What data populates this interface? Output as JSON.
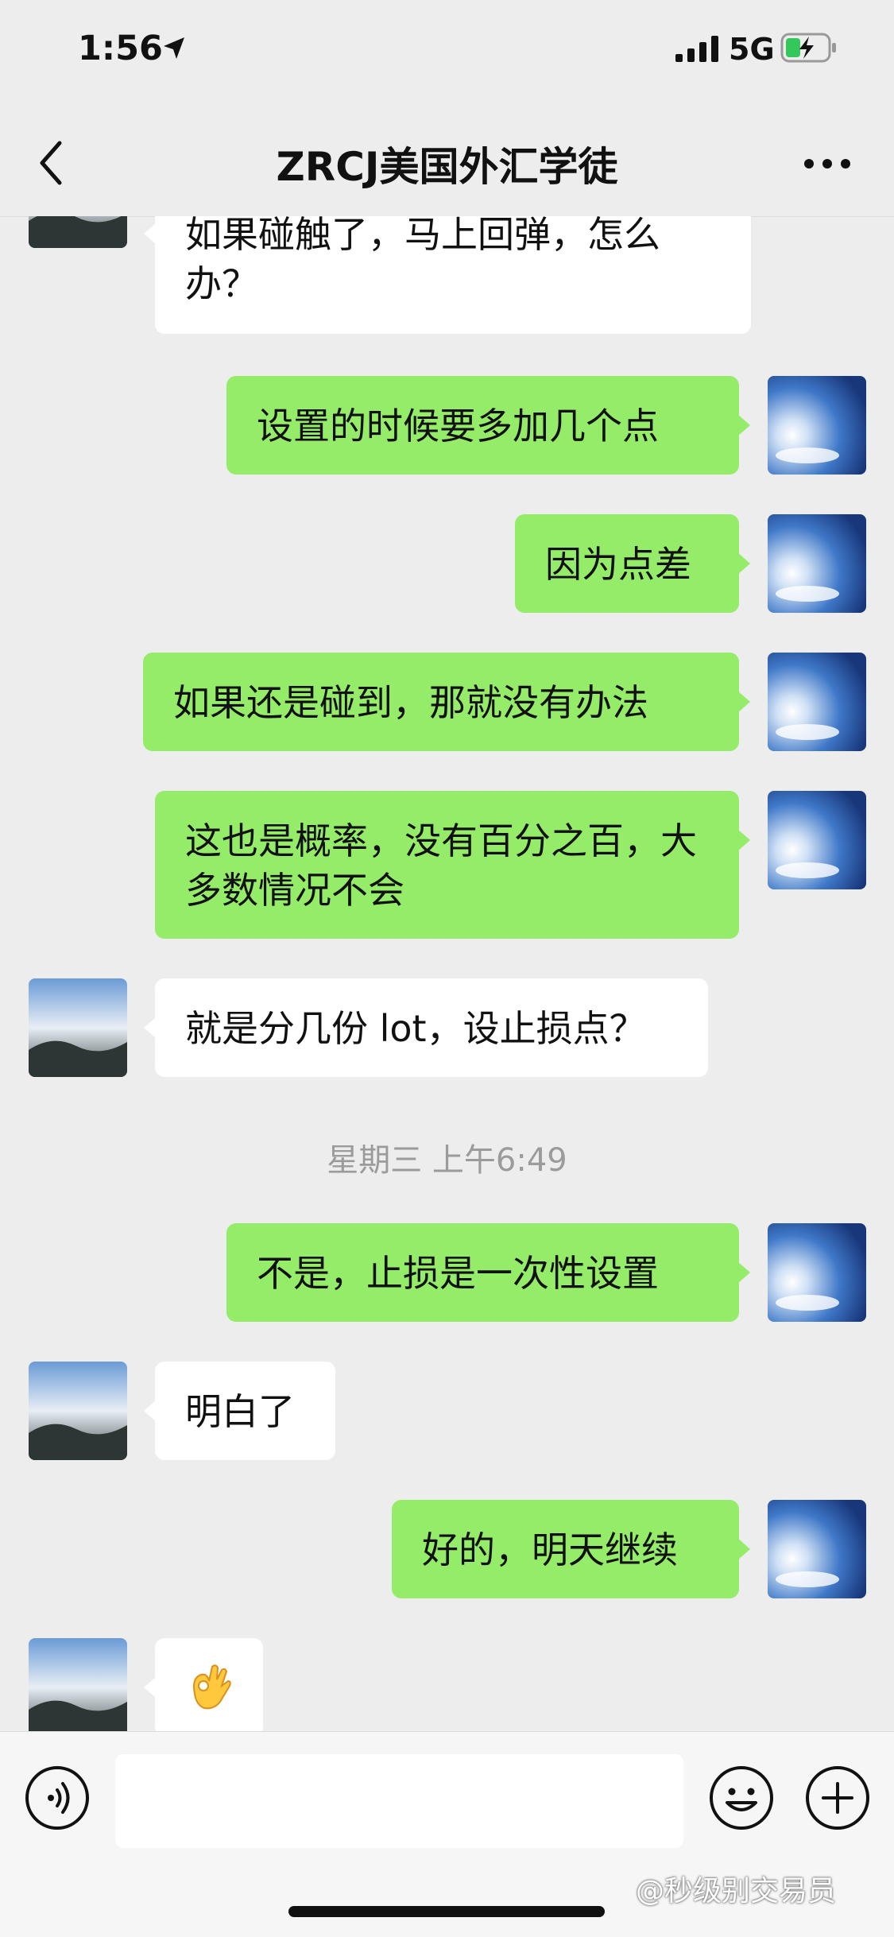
{
  "status_bar": {
    "time": "1:56",
    "network": "5G",
    "icons": [
      "location-arrow-icon",
      "signal-icon",
      "battery-charging-icon"
    ]
  },
  "nav": {
    "title": "ZRCJ美国外汇学徒",
    "back_icon": "chevron-left-icon",
    "more_icon": "more-dots-icon"
  },
  "messages": [
    {
      "from": "them",
      "text": "如果碰触了，马上回弹，怎么办？"
    },
    {
      "from": "me",
      "text": "设置的时候要多加几个点"
    },
    {
      "from": "me",
      "text": "因为点差"
    },
    {
      "from": "me",
      "text": "如果还是碰到，那就没有办法"
    },
    {
      "from": "me",
      "text": "这也是概率，没有百分之百，大多数情况不会"
    },
    {
      "from": "them",
      "text": "就是分几份 lot，设止损点？"
    },
    {
      "timestamp": "星期三 上午6:49"
    },
    {
      "from": "me",
      "text": "不是，止损是一次性设置"
    },
    {
      "from": "them",
      "text": "明白了"
    },
    {
      "from": "me",
      "text": "好的，明天继续"
    },
    {
      "from": "them",
      "emoji": "ok-hand-emoji"
    }
  ],
  "input_bar": {
    "voice_icon": "voice-icon",
    "emoji_icon": "smiley-icon",
    "add_icon": "plus-circle-icon",
    "text_value": ""
  },
  "watermark": "@秒级别交易员",
  "colors": {
    "background": "#ededed",
    "my_bubble": "#95ec69",
    "their_bubble": "#ffffff",
    "timestamp": "#9b9b9b"
  }
}
